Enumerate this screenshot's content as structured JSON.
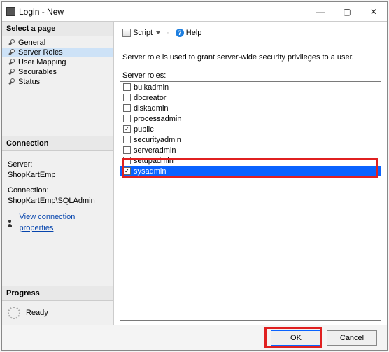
{
  "window": {
    "title": "Login - New"
  },
  "sidebar": {
    "select_page_header": "Select a page",
    "pages": [
      {
        "label": "General"
      },
      {
        "label": "Server Roles"
      },
      {
        "label": "User Mapping"
      },
      {
        "label": "Securables"
      },
      {
        "label": "Status"
      }
    ],
    "selected_index": 1,
    "connection_header": "Connection",
    "server_label": "Server:",
    "server_value": "ShopKartEmp",
    "connection_label": "Connection:",
    "connection_value": "ShopKartEmp\\SQLAdmin",
    "view_props_link": "View connection properties",
    "progress_header": "Progress",
    "progress_text": "Ready"
  },
  "toolbar": {
    "script_label": "Script",
    "help_label": "Help"
  },
  "main": {
    "description": "Server role is used to grant server-wide security privileges to a user.",
    "roles_label": "Server roles:",
    "roles": [
      {
        "name": "bulkadmin",
        "checked": false
      },
      {
        "name": "dbcreator",
        "checked": false
      },
      {
        "name": "diskadmin",
        "checked": false
      },
      {
        "name": "processadmin",
        "checked": false
      },
      {
        "name": "public",
        "checked": true
      },
      {
        "name": "securityadmin",
        "checked": false
      },
      {
        "name": "serveradmin",
        "checked": false
      },
      {
        "name": "setupadmin",
        "checked": false
      },
      {
        "name": "sysadmin",
        "checked": true
      }
    ],
    "selected_role_index": 8
  },
  "footer": {
    "ok_label": "OK",
    "cancel_label": "Cancel"
  }
}
